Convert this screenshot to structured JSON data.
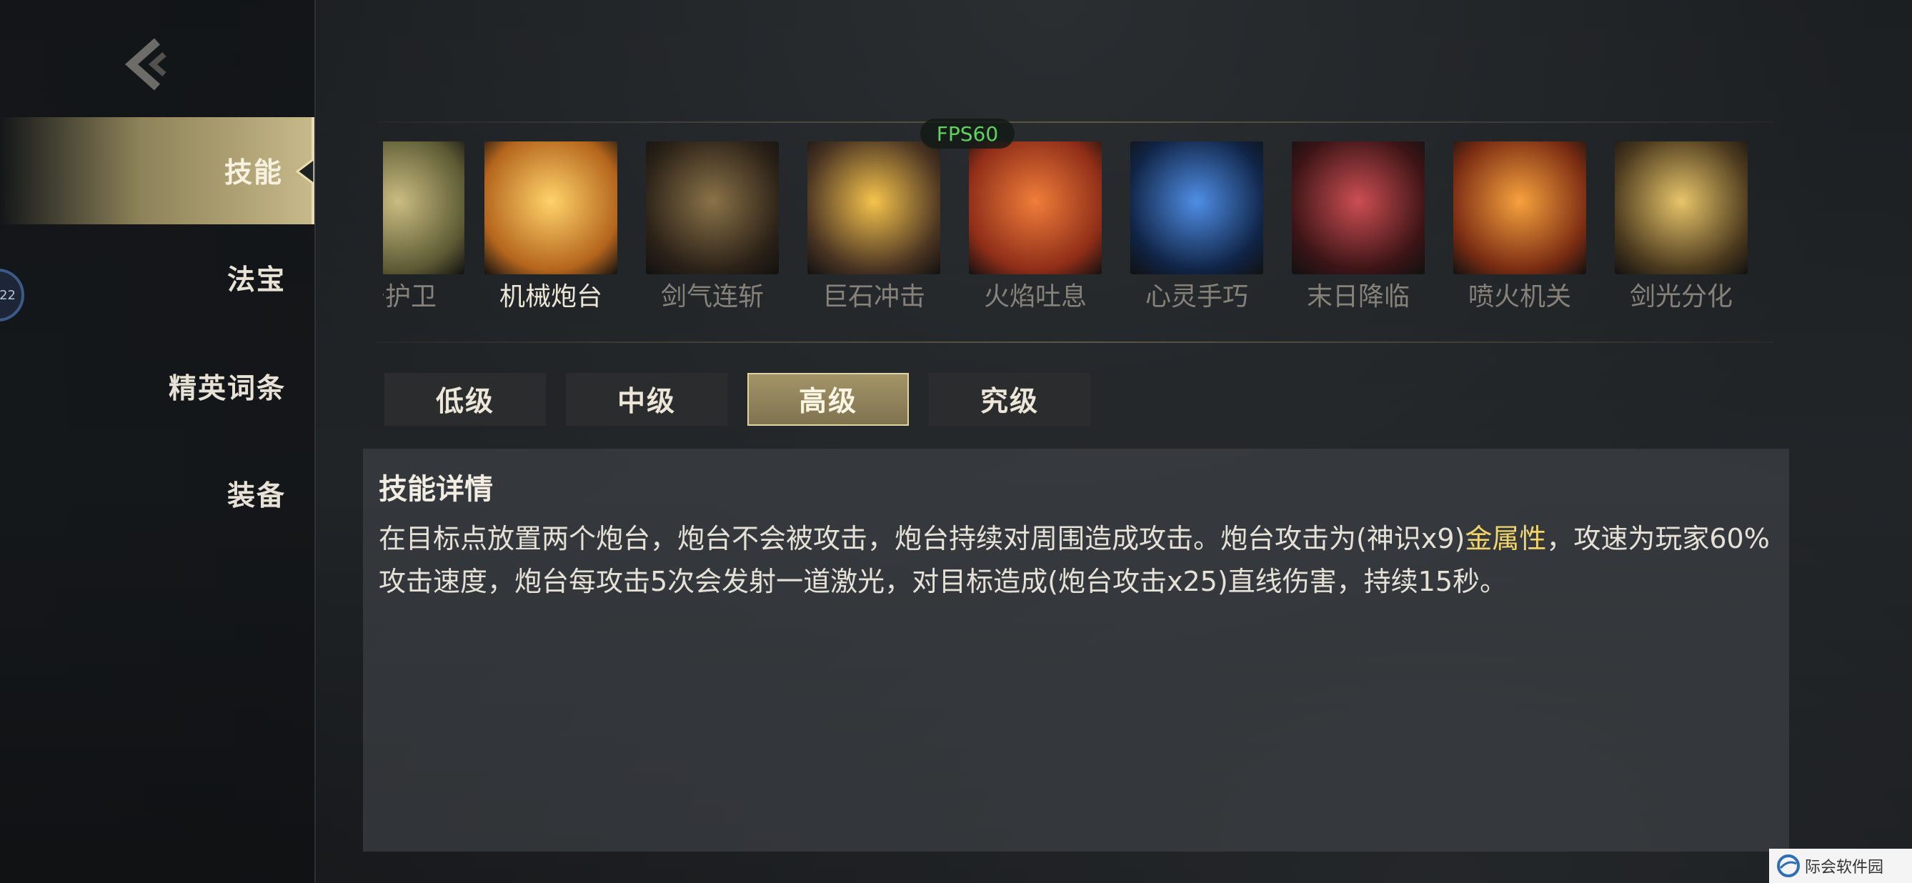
{
  "nav": {
    "items": [
      {
        "label": "技能",
        "active": true
      },
      {
        "label": "法宝",
        "active": false
      },
      {
        "label": "精英词条",
        "active": false
      },
      {
        "label": "装备",
        "active": false
      }
    ]
  },
  "fps": "FPS60",
  "skills": [
    {
      "name": "守护卫",
      "palette": [
        "#cbbd82",
        "#5c5a34"
      ]
    },
    {
      "name": "机械炮台",
      "palette": [
        "#ffd36a",
        "#b4651c"
      ],
      "selected": true
    },
    {
      "name": "剑气连斩",
      "palette": [
        "#8b7348",
        "#2c2218"
      ]
    },
    {
      "name": "巨石冲击",
      "palette": [
        "#f5c34c",
        "#4a3422"
      ]
    },
    {
      "name": "火焰吐息",
      "palette": [
        "#f07e3a",
        "#8e2d18"
      ]
    },
    {
      "name": "心灵手巧",
      "palette": [
        "#4f8ee6",
        "#102446"
      ]
    },
    {
      "name": "末日降临",
      "palette": [
        "#cc4e52",
        "#3c1416"
      ]
    },
    {
      "name": "喷火机关",
      "palette": [
        "#f6a23e",
        "#7a2c12"
      ]
    },
    {
      "name": "剑光分化",
      "palette": [
        "#e7c56a",
        "#4c3a1e"
      ]
    }
  ],
  "tiers": {
    "items": [
      {
        "label": "低级",
        "active": false
      },
      {
        "label": "中级",
        "active": false
      },
      {
        "label": "高级",
        "active": true
      },
      {
        "label": "究级",
        "active": false
      }
    ]
  },
  "details": {
    "title": "技能详情",
    "text_before": "在目标点放置两个炮台，炮台不会被攻击，炮台持续对周围造成攻击。炮台攻击为(神识x9)",
    "highlight": "金属性",
    "text_after": "，攻速为玩家60%攻击速度，炮台每攻击5次会发射一道激光，对目标造成(炮台攻击x25)直线伤害，持续15秒。"
  },
  "avatar_text": "22",
  "watermark": "际会软件园",
  "colors": {
    "accent_gold": "#c7b98a",
    "highlight": "#f1d46a",
    "fps_green": "#5fd35f"
  }
}
